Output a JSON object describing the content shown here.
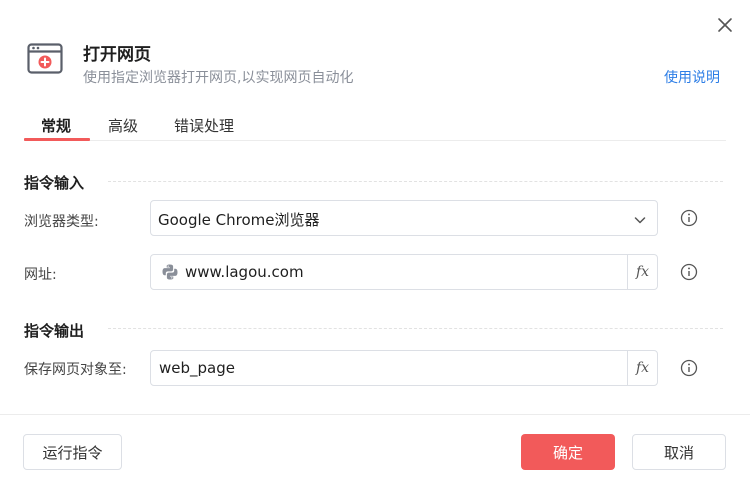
{
  "header": {
    "title": "打开网页",
    "subtitle": "使用指定浏览器打开网页,以实现网页自动化",
    "help_link": "使用说明"
  },
  "tabs": [
    {
      "label": "常规",
      "active": true
    },
    {
      "label": "高级",
      "active": false
    },
    {
      "label": "错误处理",
      "active": false
    }
  ],
  "sections": {
    "input_title": "指令输入",
    "output_title": "指令输出"
  },
  "fields": {
    "browser_type": {
      "label": "浏览器类型:",
      "value": "Google Chrome浏览器"
    },
    "url": {
      "label": "网址:",
      "value": "www.lagou.com"
    },
    "save_to": {
      "label": "保存网页对象至:",
      "value": "web_page"
    }
  },
  "fx_label": "fx",
  "footer": {
    "run_label": "运行指令",
    "ok_label": "确定",
    "cancel_label": "取消"
  },
  "colors": {
    "accent": "#f25a5a",
    "link": "#2d7ee6"
  }
}
